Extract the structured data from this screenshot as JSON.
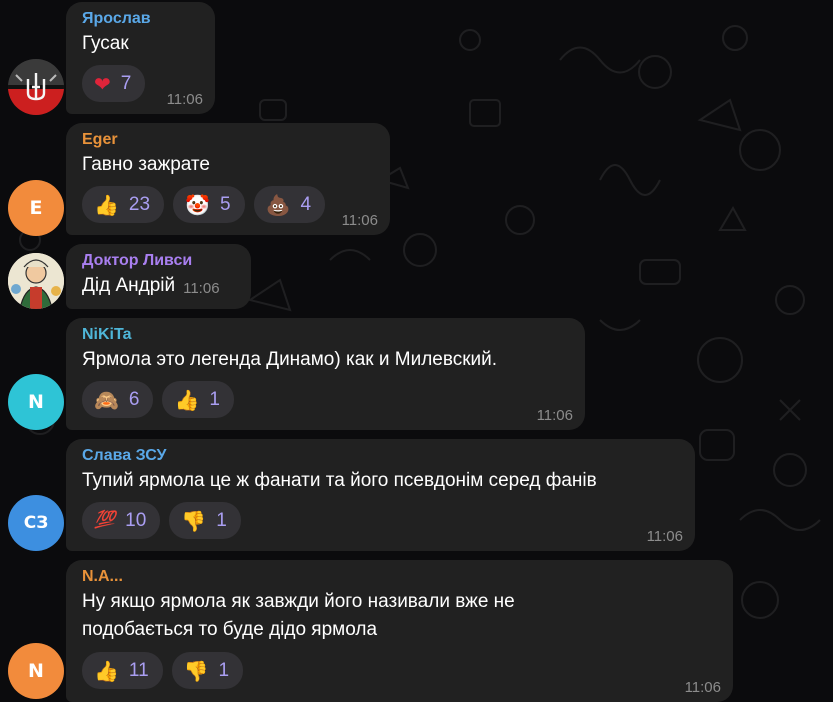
{
  "messages": [
    {
      "sender": "Ярослав",
      "sender_color": "#5aa8e8",
      "text": "Гусак",
      "time": "11:06",
      "avatar_icon": "trident-flag-icon",
      "reactions": [
        {
          "emoji": "❤",
          "icon": "heart-icon",
          "count": "7"
        }
      ]
    },
    {
      "sender": "Eger",
      "sender_color": "#e8923a",
      "text": "Гавно зажрате",
      "time": "11:06",
      "avatar_letter": "E",
      "avatar_color": "#f28b3c",
      "reactions": [
        {
          "emoji": "👍",
          "icon": "thumbs-up-icon",
          "count": "23"
        },
        {
          "emoji": "🤡",
          "icon": "clown-face-icon",
          "count": "5"
        },
        {
          "emoji": "💩",
          "icon": "poop-icon",
          "count": "4"
        }
      ]
    },
    {
      "sender": "Доктор Ливси",
      "sender_color": "#a97ff0",
      "text": "Дід Андрій",
      "time": "11:06",
      "avatar_icon": "cartoon-portrait-icon"
    },
    {
      "sender": "NiKiTa",
      "sender_color": "#4fb6d8",
      "text": "Ярмола это легенда Динамо) как и Милевский.",
      "time": "11:06",
      "avatar_letter": "N",
      "avatar_color": "#2ec4d6",
      "reactions": [
        {
          "emoji": "🙈",
          "icon": "see-no-evil-monkey-icon",
          "count": "6"
        },
        {
          "emoji": "👍",
          "icon": "thumbs-up-icon",
          "count": "1"
        }
      ]
    },
    {
      "sender": "Слава ЗСУ",
      "sender_color": "#5aa8e8",
      "text": "Тупий ярмола це ж фанати та його псевдонім серед фанів",
      "time": "11:06",
      "avatar_letter": "СЗ",
      "avatar_color": "#3d8fe0",
      "reactions": [
        {
          "emoji": "💯",
          "icon": "hundred-points-icon",
          "count": "10"
        },
        {
          "emoji": "👎",
          "icon": "thumbs-down-icon",
          "count": "1"
        }
      ]
    },
    {
      "sender": "N.A...",
      "sender_color": "#e8923a",
      "text_lines": [
        "Ну якщо ярмола як завжди його називали вже не",
        "подобається то буде дідо ярмола"
      ],
      "time": "11:06",
      "avatar_letter": "N",
      "avatar_color": "#f28b3c",
      "reactions": [
        {
          "emoji": "👍",
          "icon": "thumbs-up-icon",
          "count": "11"
        },
        {
          "emoji": "👎",
          "icon": "thumbs-down-icon",
          "count": "1"
        }
      ]
    }
  ]
}
